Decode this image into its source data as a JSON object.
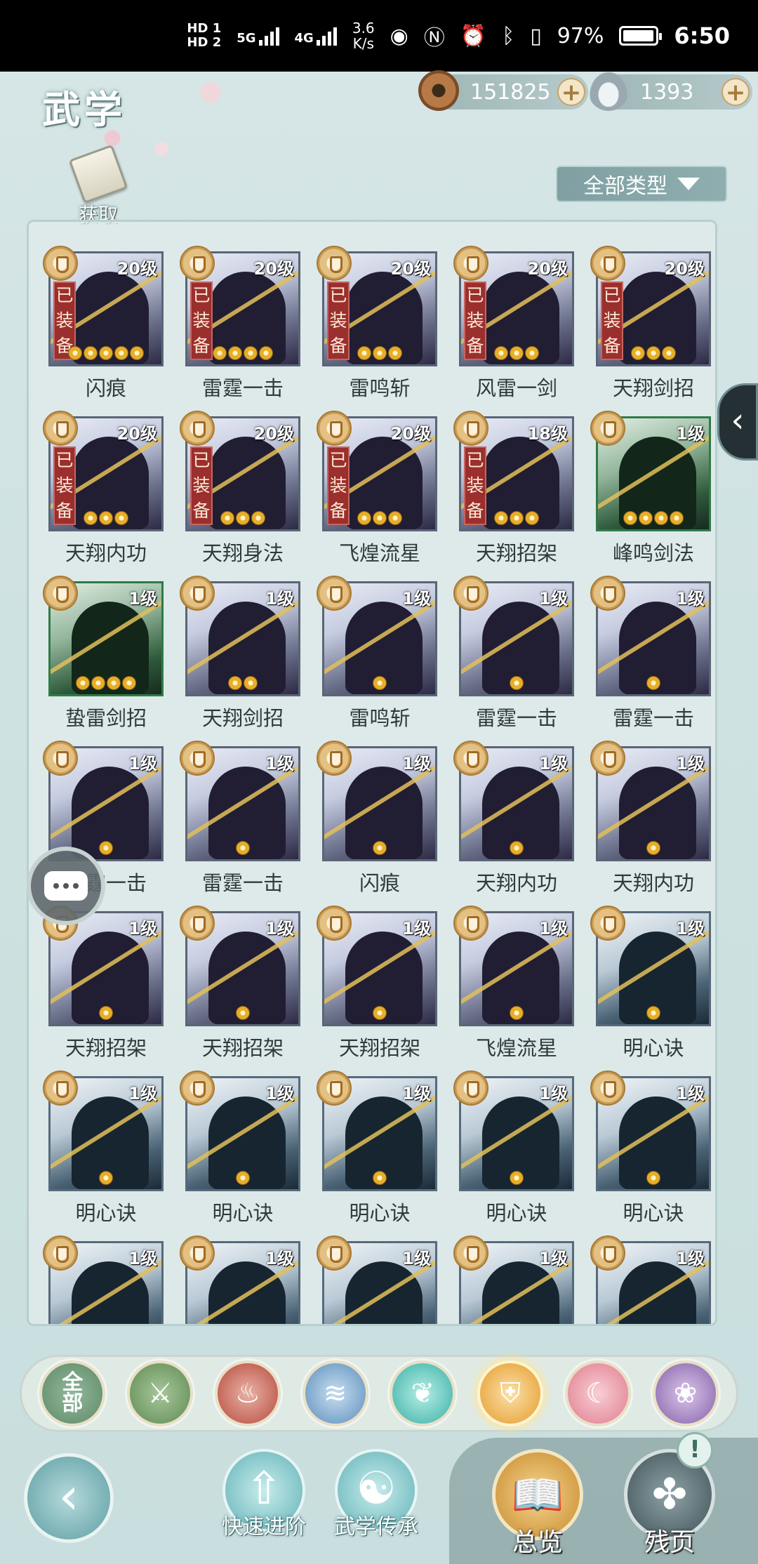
{
  "status_bar": {
    "sim1": "HD 1",
    "sim2": "HD 2",
    "net1": "5G",
    "net2": "4G",
    "speed_value": "3.6",
    "speed_unit": "K/s",
    "battery": "97%",
    "battery_level": 0.97,
    "time": "6:50",
    "icons": [
      "eye-icon",
      "nfc-icon",
      "alarm-icon",
      "bluetooth-icon",
      "vibrate-icon"
    ]
  },
  "header": {
    "title": "武学",
    "copper_coins": "151825",
    "silver": "1393",
    "plus": "+",
    "acquire": "获取",
    "type_filter": "全部类型"
  },
  "equipped_text": "已装备",
  "skills": [
    {
      "name": "闪痕",
      "level": "20级",
      "equipped": true,
      "stars": 5,
      "tint": "purple"
    },
    {
      "name": "雷霆一击",
      "level": "20级",
      "equipped": true,
      "stars": 4,
      "tint": "purple"
    },
    {
      "name": "雷鸣斩",
      "level": "20级",
      "equipped": true,
      "stars": 3,
      "tint": "purple"
    },
    {
      "name": "风雷一剑",
      "level": "20级",
      "equipped": true,
      "stars": 3,
      "tint": "purple"
    },
    {
      "name": "天翔剑招",
      "level": "20级",
      "equipped": true,
      "stars": 3,
      "tint": "purple"
    },
    {
      "name": "天翔内功",
      "level": "20级",
      "equipped": true,
      "stars": 3,
      "tint": "purple"
    },
    {
      "name": "天翔身法",
      "level": "20级",
      "equipped": true,
      "stars": 3,
      "tint": "purple"
    },
    {
      "name": "飞煌流星",
      "level": "20级",
      "equipped": true,
      "stars": 3,
      "tint": "purple"
    },
    {
      "name": "天翔招架",
      "level": "18级",
      "equipped": true,
      "stars": 3,
      "tint": "purple"
    },
    {
      "name": "峰鸣剑法",
      "level": "1级",
      "equipped": false,
      "stars": 4,
      "tint": "green"
    },
    {
      "name": "蛰雷剑招",
      "level": "1级",
      "equipped": false,
      "stars": 4,
      "tint": "green"
    },
    {
      "name": "天翔剑招",
      "level": "1级",
      "equipped": false,
      "stars": 2,
      "tint": "purple"
    },
    {
      "name": "雷鸣斩",
      "level": "1级",
      "equipped": false,
      "stars": 1,
      "tint": "purple"
    },
    {
      "name": "雷霆一击",
      "level": "1级",
      "equipped": false,
      "stars": 1,
      "tint": "purple"
    },
    {
      "name": "雷霆一击",
      "level": "1级",
      "equipped": false,
      "stars": 1,
      "tint": "purple"
    },
    {
      "name": "雷霆一击",
      "level": "1级",
      "equipped": false,
      "stars": 1,
      "tint": "purple"
    },
    {
      "name": "雷霆一击",
      "level": "1级",
      "equipped": false,
      "stars": 1,
      "tint": "purple"
    },
    {
      "name": "闪痕",
      "level": "1级",
      "equipped": false,
      "stars": 1,
      "tint": "purple"
    },
    {
      "name": "天翔内功",
      "level": "1级",
      "equipped": false,
      "stars": 1,
      "tint": "purple"
    },
    {
      "name": "天翔内功",
      "level": "1级",
      "equipped": false,
      "stars": 1,
      "tint": "purple"
    },
    {
      "name": "天翔招架",
      "level": "1级",
      "equipped": false,
      "stars": 1,
      "tint": "purple"
    },
    {
      "name": "天翔招架",
      "level": "1级",
      "equipped": false,
      "stars": 1,
      "tint": "purple"
    },
    {
      "name": "天翔招架",
      "level": "1级",
      "equipped": false,
      "stars": 1,
      "tint": "purple"
    },
    {
      "name": "飞煌流星",
      "level": "1级",
      "equipped": false,
      "stars": 1,
      "tint": "purple"
    },
    {
      "name": "明心诀",
      "level": "1级",
      "equipped": false,
      "stars": 1,
      "tint": "blue"
    },
    {
      "name": "明心诀",
      "level": "1级",
      "equipped": false,
      "stars": 1,
      "tint": "blue"
    },
    {
      "name": "明心诀",
      "level": "1级",
      "equipped": false,
      "stars": 1,
      "tint": "blue"
    },
    {
      "name": "明心诀",
      "level": "1级",
      "equipped": false,
      "stars": 1,
      "tint": "blue"
    },
    {
      "name": "明心诀",
      "level": "1级",
      "equipped": false,
      "stars": 1,
      "tint": "blue"
    },
    {
      "name": "明心诀",
      "level": "1级",
      "equipped": false,
      "stars": 1,
      "tint": "blue"
    },
    {
      "name": "",
      "level": "1级",
      "equipped": false,
      "stars": 0,
      "tint": "blue"
    },
    {
      "name": "",
      "level": "1级",
      "equipped": false,
      "stars": 0,
      "tint": "blue"
    },
    {
      "name": "",
      "level": "1级",
      "equipped": false,
      "stars": 0,
      "tint": "blue"
    },
    {
      "name": "",
      "level": "1级",
      "equipped": false,
      "stars": 0,
      "tint": "blue"
    },
    {
      "name": "",
      "level": "1级",
      "equipped": false,
      "stars": 0,
      "tint": "blue"
    }
  ],
  "categories": {
    "all_label": "全\n部",
    "icons": [
      "sword-category-icon",
      "fire-category-icon",
      "water-category-icon",
      "butterfly-category-icon",
      "shield-category-icon",
      "moon-category-icon",
      "rose-category-icon"
    ]
  },
  "bottom": {
    "quick_advance": "快速进阶",
    "inherit": "武学传承",
    "overview": "总览",
    "fragments": "残页",
    "alert": "!"
  }
}
